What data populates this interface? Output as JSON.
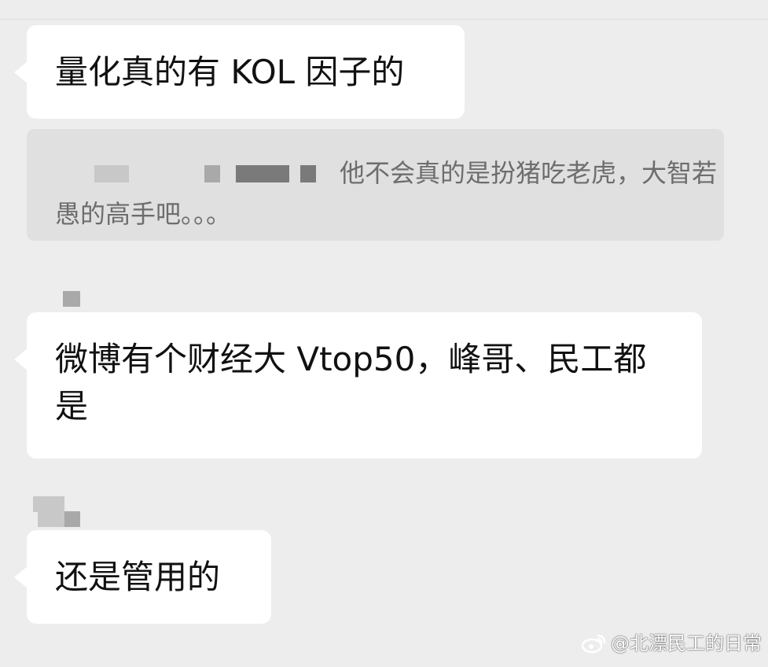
{
  "chat": {
    "messages": [
      {
        "text": "量化真的有 KOL 因子的"
      },
      {
        "quote": {
          "text": "他不会真的是扮猪吃老虎，大智若愚的高手吧。。。"
        }
      },
      {
        "text": "微博有个财经大 Vtop50，峰哥、民工都是"
      },
      {
        "text": "还是管用的"
      }
    ]
  },
  "watermark": {
    "text": "@北漂民工的日常",
    "icon": "weibo-icon"
  },
  "colors": {
    "background": "#ededed",
    "bubble": "#ffffff",
    "quote_bg": "#e0e0e0",
    "quote_text": "#6d6d6d",
    "text": "#111111"
  }
}
